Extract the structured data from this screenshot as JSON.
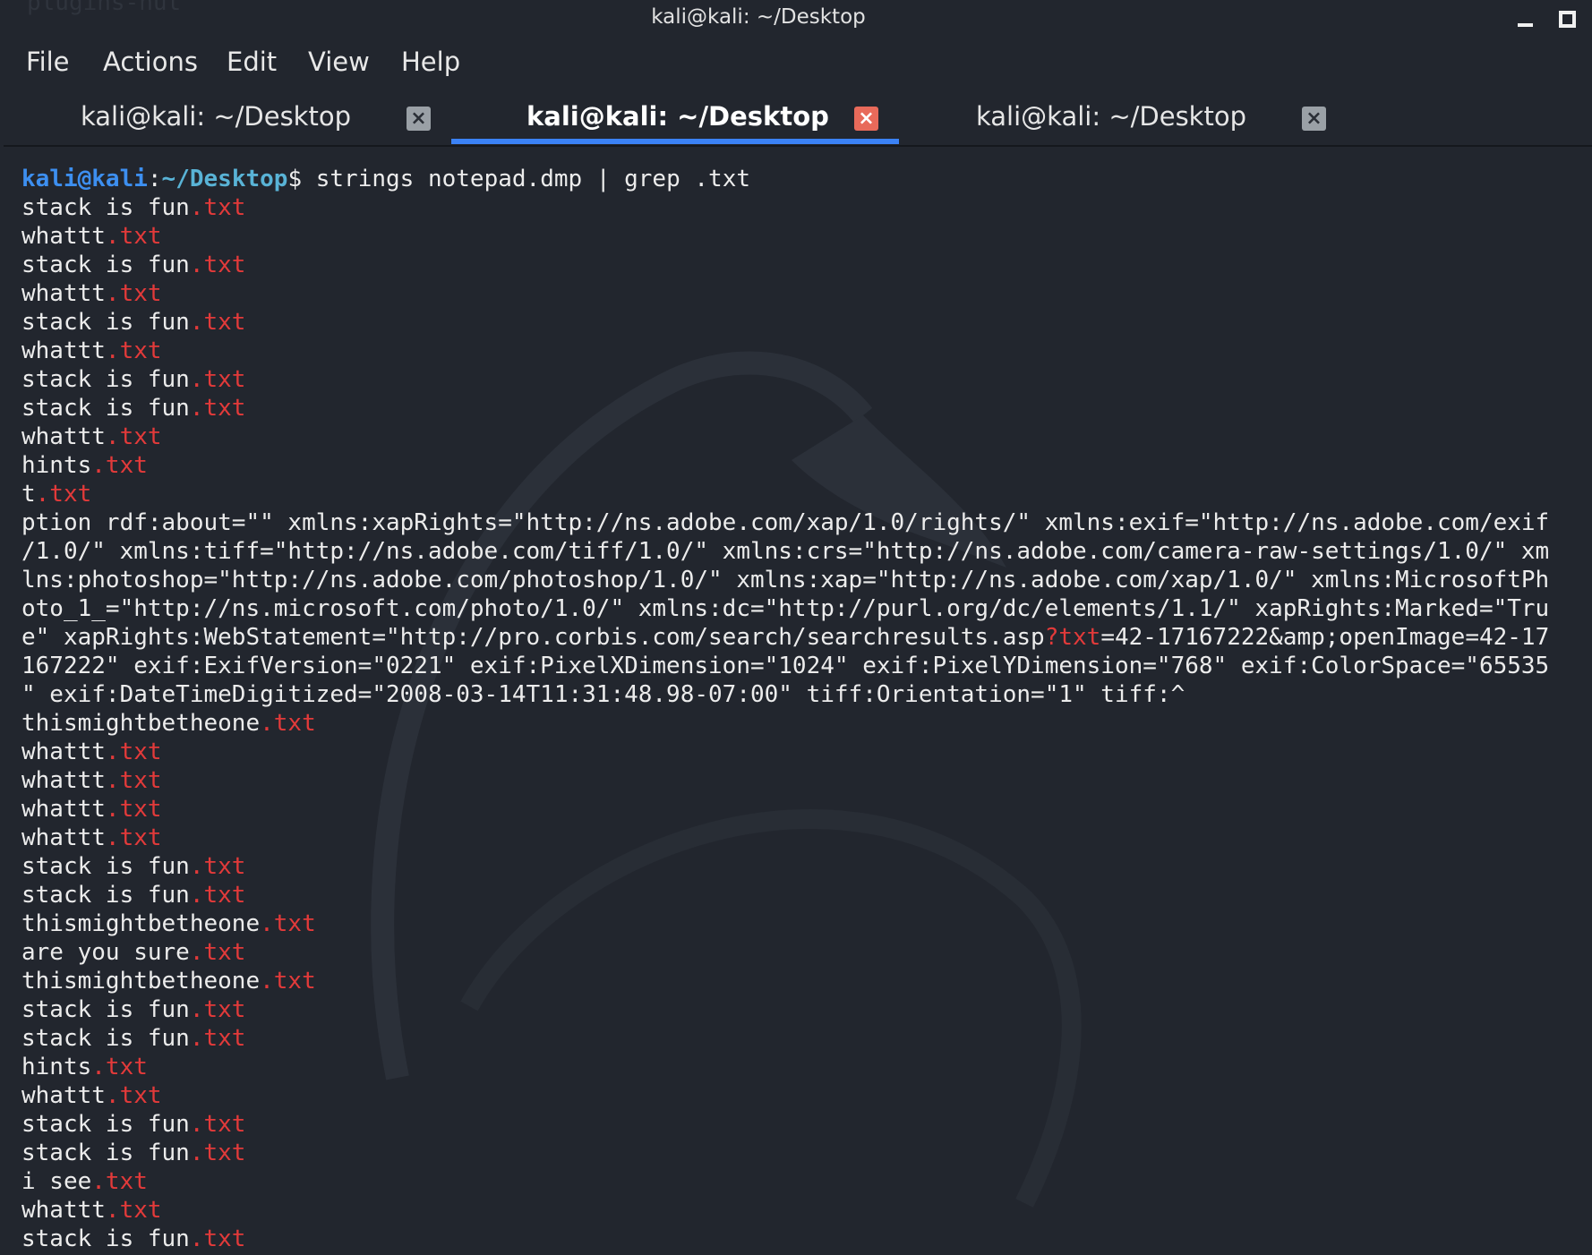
{
  "window": {
    "title": "kali@kali: ~/Desktop",
    "faded_title": "plugins-nut"
  },
  "menu": [
    "File",
    "Actions",
    "Edit",
    "View",
    "Help"
  ],
  "tabs": [
    {
      "label": "kali@kali: ~/Desktop",
      "active": false
    },
    {
      "label": "kali@kali: ~/Desktop",
      "active": true
    },
    {
      "label": "kali@kali: ~/Desktop",
      "active": false
    }
  ],
  "terminal": {
    "prompt_user": "kali@kali",
    "prompt_sep": ":",
    "prompt_path": "~/Desktop",
    "prompt_dollar": "$",
    "command": " strings notepad.dmp | grep .txt",
    "highlight_color": "#e23a3a",
    "lines": [
      [
        [
          "stack is fun",
          false
        ],
        [
          ".txt",
          true
        ]
      ],
      [
        [
          "whattt",
          false
        ],
        [
          ".txt",
          true
        ]
      ],
      [
        [
          "stack is fun",
          false
        ],
        [
          ".txt",
          true
        ]
      ],
      [
        [
          "whattt",
          false
        ],
        [
          ".txt",
          true
        ]
      ],
      [
        [
          "stack is fun",
          false
        ],
        [
          ".txt",
          true
        ]
      ],
      [
        [
          "whattt",
          false
        ],
        [
          ".txt",
          true
        ]
      ],
      [
        [
          "stack is fun",
          false
        ],
        [
          ".txt",
          true
        ]
      ],
      [
        [
          "stack is fun",
          false
        ],
        [
          ".txt",
          true
        ]
      ],
      [
        [
          "whattt",
          false
        ],
        [
          ".txt",
          true
        ]
      ],
      [
        [
          "hints",
          false
        ],
        [
          ".txt",
          true
        ]
      ],
      [
        [
          "t",
          false
        ],
        [
          ".txt",
          true
        ]
      ],
      [
        [
          "ption rdf:about=\"\" xmlns:xapRights=\"http://ns.adobe.com/xap/1.0/rights/\" xmlns:exif=\"http://ns.adobe.com/exif",
          false
        ]
      ],
      [
        [
          "/1.0/\" xmlns:tiff=\"http://ns.adobe.com/tiff/1.0/\" xmlns:crs=\"http://ns.adobe.com/camera-raw-settings/1.0/\" xm",
          false
        ]
      ],
      [
        [
          "lns:photoshop=\"http://ns.adobe.com/photoshop/1.0/\" xmlns:xap=\"http://ns.adobe.com/xap/1.0/\" xmlns:MicrosoftPh",
          false
        ]
      ],
      [
        [
          "oto_1_=\"http://ns.microsoft.com/photo/1.0/\" xmlns:dc=\"http://purl.org/dc/elements/1.1/\" xapRights:Marked=\"Tru",
          false
        ]
      ],
      [
        [
          "e\" xapRights:WebStatement=\"http://pro.corbis.com/search/searchresults.asp",
          false
        ],
        [
          "?txt",
          true
        ],
        [
          "=42-17167222&amp;openImage=42-17",
          false
        ]
      ],
      [
        [
          "167222\" exif:ExifVersion=\"0221\" exif:PixelXDimension=\"1024\" exif:PixelYDimension=\"768\" exif:ColorSpace=\"65535",
          false
        ]
      ],
      [
        [
          "\" exif:DateTimeDigitized=\"2008-03-14T11:31:48.98-07:00\" tiff:Orientation=\"1\" tiff:^",
          false
        ]
      ],
      [
        [
          "thismightbetheone",
          false
        ],
        [
          ".txt",
          true
        ]
      ],
      [
        [
          "whattt",
          false
        ],
        [
          ".txt",
          true
        ]
      ],
      [
        [
          "whattt",
          false
        ],
        [
          ".txt",
          true
        ]
      ],
      [
        [
          "whattt",
          false
        ],
        [
          ".txt",
          true
        ]
      ],
      [
        [
          "whattt",
          false
        ],
        [
          ".txt",
          true
        ]
      ],
      [
        [
          "stack is fun",
          false
        ],
        [
          ".txt",
          true
        ]
      ],
      [
        [
          "stack is fun",
          false
        ],
        [
          ".txt",
          true
        ]
      ],
      [
        [
          "thismightbetheone",
          false
        ],
        [
          ".txt",
          true
        ]
      ],
      [
        [
          "are you sure",
          false
        ],
        [
          ".txt",
          true
        ]
      ],
      [
        [
          "thismightbetheone",
          false
        ],
        [
          ".txt",
          true
        ]
      ],
      [
        [
          "stack is fun",
          false
        ],
        [
          ".txt",
          true
        ]
      ],
      [
        [
          "stack is fun",
          false
        ],
        [
          ".txt",
          true
        ]
      ],
      [
        [
          "hints",
          false
        ],
        [
          ".txt",
          true
        ]
      ],
      [
        [
          "whattt",
          false
        ],
        [
          ".txt",
          true
        ]
      ],
      [
        [
          "stack is fun",
          false
        ],
        [
          ".txt",
          true
        ]
      ],
      [
        [
          "stack is fun",
          false
        ],
        [
          ".txt",
          true
        ]
      ],
      [
        [
          "i see",
          false
        ],
        [
          ".txt",
          true
        ]
      ],
      [
        [
          "whattt",
          false
        ],
        [
          ".txt",
          true
        ]
      ],
      [
        [
          "stack is fun",
          false
        ],
        [
          ".txt",
          true
        ]
      ]
    ]
  }
}
